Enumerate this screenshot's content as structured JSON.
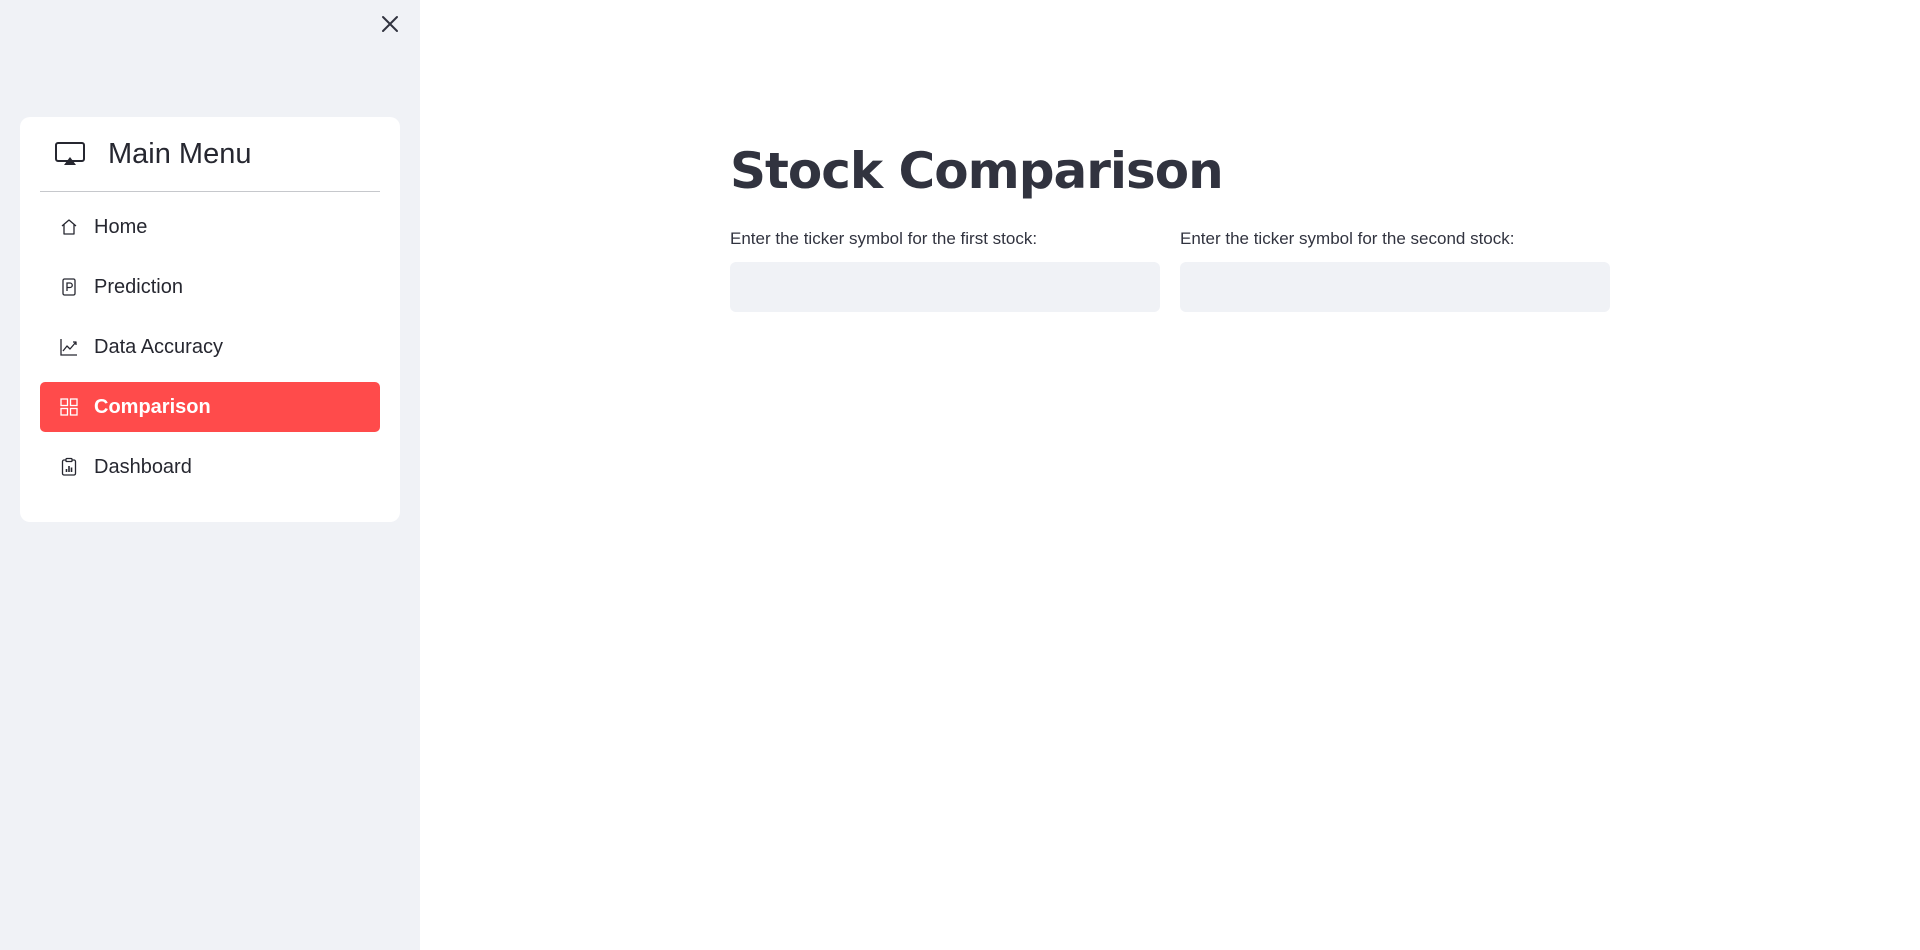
{
  "sidebar": {
    "close_icon": "close-icon",
    "menu": {
      "title": "Main Menu",
      "title_icon": "airplay-icon",
      "items": [
        {
          "label": "Home",
          "icon": "house-icon",
          "active": false
        },
        {
          "label": "Prediction",
          "icon": "p-square-icon",
          "active": false
        },
        {
          "label": "Data Accuracy",
          "icon": "graph-up-icon",
          "active": false
        },
        {
          "label": "Comparison",
          "icon": "grid-icon",
          "active": true
        },
        {
          "label": "Dashboard",
          "icon": "clipboard-data-icon",
          "active": false
        }
      ],
      "active_color": "#ff4b4b"
    }
  },
  "main": {
    "title": "Stock Comparison",
    "fields": [
      {
        "label": "Enter the ticker symbol for the first stock:",
        "value": ""
      },
      {
        "label": "Enter the ticker symbol for the second stock:",
        "value": ""
      }
    ]
  }
}
